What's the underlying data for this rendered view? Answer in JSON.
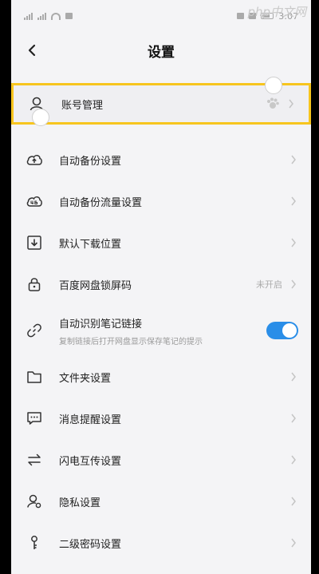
{
  "status": {
    "time": "3:07"
  },
  "watermark": "php中文网",
  "header": {
    "title": "设置"
  },
  "items": [
    {
      "label": "账号管理",
      "icon": "user-icon"
    },
    {
      "label": "自动备份设置",
      "icon": "cloud-upload-icon"
    },
    {
      "label": "自动备份流量设置",
      "icon": "cloud-4g-icon"
    },
    {
      "label": "默认下载位置",
      "icon": "download-icon"
    },
    {
      "label": "百度网盘锁屏码",
      "icon": "lock-icon",
      "value": "未开启"
    },
    {
      "label": "自动识别笔记链接",
      "sub": "复制链接后打开网盘显示保存笔记的提示",
      "icon": "link-icon",
      "toggle": true
    },
    {
      "label": "文件夹设置",
      "icon": "folder-icon"
    },
    {
      "label": "消息提醒设置",
      "icon": "message-icon"
    },
    {
      "label": "闪电互传设置",
      "icon": "transfer-icon"
    },
    {
      "label": "隐私设置",
      "icon": "privacy-icon"
    },
    {
      "label": "二级密码设置",
      "icon": "key-icon"
    }
  ],
  "colors": {
    "highlight": "#f7c51e",
    "toggle_on": "#2a8ee8"
  }
}
